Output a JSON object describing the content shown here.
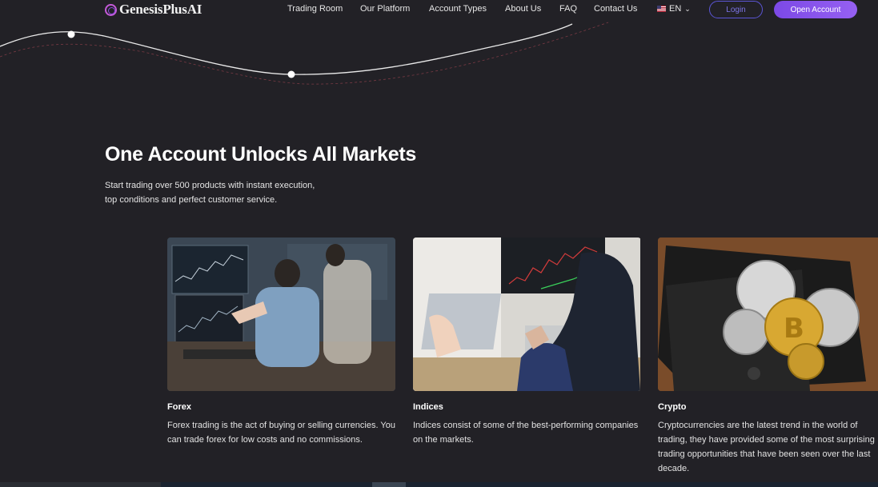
{
  "header": {
    "logo_text": "GenesisPlusAI",
    "nav": [
      {
        "label": "Trading Room"
      },
      {
        "label": "Our Platform"
      },
      {
        "label": "Account Types"
      },
      {
        "label": "About Us"
      },
      {
        "label": "FAQ"
      },
      {
        "label": "Contact Us"
      }
    ],
    "language": "EN",
    "login_label": "Login",
    "open_account_label": "Open Account"
  },
  "hero": {
    "title": "One Account Unlocks All Markets",
    "subtitle_line1": "Start trading over 500 products with instant execution,",
    "subtitle_line2": "top conditions and perfect customer service."
  },
  "cards": [
    {
      "title": "Forex",
      "description": "Forex trading is the act of buying or selling currencies. You can trade forex for low costs and no commissions.",
      "image": "trader-monitors-photo"
    },
    {
      "title": "Indices",
      "description": "Indices consist of some of the best-performing companies on the markets.",
      "image": "laptop-chart-photo"
    },
    {
      "title": "Crypto",
      "description": "Cryptocurrencies are the latest trend in the world of trading, they have provided some of the most surprising trading opportunities that have been seen over the last decade.",
      "image": "crypto-coins-wallet-photo"
    }
  ],
  "colors": {
    "background": "#222126",
    "accent": "#8655ec",
    "login_border": "#5b55d6"
  }
}
